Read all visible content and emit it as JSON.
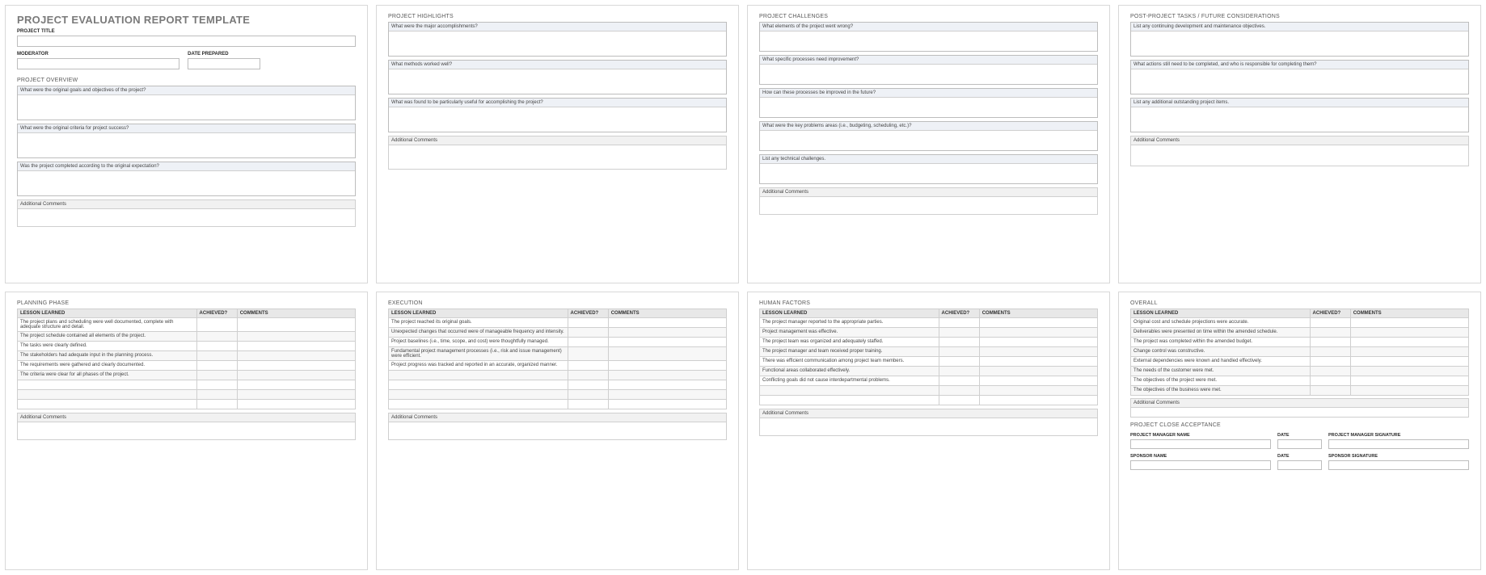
{
  "p1": {
    "title": "PROJECT EVALUATION REPORT TEMPLATE",
    "project_title_label": "PROJECT TITLE",
    "moderator_label": "MODERATOR",
    "date_prepared_label": "DATE PREPARED",
    "overview_title": "PROJECT OVERVIEW",
    "q1": "What were the original goals and objectives of the project?",
    "q2": "What were the original criteria for project success?",
    "q3": "Was the project completed according to the original expectation?",
    "ac": "Additional Comments"
  },
  "p2": {
    "title": "PROJECT HIGHLIGHTS",
    "q1": "What were the major accomplishments?",
    "q2": "What methods worked well?",
    "q3": "What was found to be particularly useful for accomplishing the project?",
    "ac": "Additional Comments"
  },
  "p3": {
    "title": "PROJECT CHALLENGES",
    "q1": "What elements of the project went wrong?",
    "q2": "What specific processes need improvement?",
    "q3": "How can these processes be improved in the future?",
    "q4": "What were the key problems areas (i.e., budgeting, scheduling, etc.)?",
    "q5": "List any technical challenges.",
    "ac": "Additional Comments"
  },
  "p4": {
    "title": "POST-PROJECT TASKS / FUTURE CONSIDERATIONS",
    "q1": "List any continuing development and maintenance objectives.",
    "q2": "What actions still need to be completed, and who is responsible for completing them?",
    "q3": "List any additional outstanding project items.",
    "ac": "Additional Comments"
  },
  "th": {
    "lesson": "LESSON LEARNED",
    "achieved": "ACHIEVED?",
    "comments": "COMMENTS"
  },
  "p5": {
    "title": "PLANNING PHASE",
    "lessons": [
      "The project plans and scheduling were well documented, complete with adequate structure and detail.",
      "The project schedule contained all elements of the project.",
      "The tasks were clearly defined.",
      "The stakeholders had adequate input in the planning process.",
      "The requirements were gathered and clearly documented.",
      "The criteria were clear for all phases of the project.",
      "",
      "",
      ""
    ],
    "ac": "Additional Comments"
  },
  "p6": {
    "title": "EXECUTION",
    "lessons": [
      "The project reached its original goals.",
      "Unexpected changes that occurred were of manageable frequency and intensity.",
      "Project baselines (i.e., time, scope, and cost) were thoughtfully managed.",
      "Fundamental project management processes (i.e., risk and issue management) were efficient.",
      "Project progress was tracked and reported in an accurate, organized manner.",
      "",
      "",
      "",
      ""
    ],
    "ac": "Additional Comments"
  },
  "p7": {
    "title": "HUMAN FACTORS",
    "lessons": [
      "The project manager reported to the appropriate parties.",
      "Project management was effective.",
      "The project team was organized and adequately staffed.",
      "The project manager and team received proper training.",
      "There was efficient communication among project team members.",
      "Functional areas collaborated effectively.",
      "Conflicting goals did not cause interdepartmental problems.",
      "",
      ""
    ],
    "ac": "Additional Comments"
  },
  "p8": {
    "title": "OVERALL",
    "lessons": [
      "Original cost and schedule projections were accurate.",
      "Deliverables were presented on time within the amended schedule.",
      "The project was completed within the amended budget.",
      "Change control was constructive.",
      "External dependencies were known and handled effectively.",
      "The needs of the customer were met.",
      "The objectives of the project were met.",
      "The objectives of the business were met."
    ],
    "ac": "Additional Comments",
    "close_title": "PROJECT CLOSE ACCEPTANCE",
    "pm_name": "PROJECT MANAGER NAME",
    "date": "DATE",
    "pm_sig": "PROJECT MANAGER SIGNATURE",
    "sp_name": "SPONSOR NAME",
    "sp_sig": "SPONSOR SIGNATURE"
  }
}
